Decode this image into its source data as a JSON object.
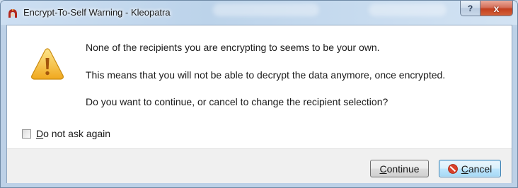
{
  "window": {
    "title": "Encrypt-To-Self Warning - Kleopatra",
    "help_glyph": "?",
    "close_glyph": "x"
  },
  "message": {
    "line1": "None of the recipients you are encrypting to seems to be your own.",
    "line2": "This means that you will not be able to decrypt the data anymore, once encrypted.",
    "line3": "Do you want to continue, or cancel to change the recipient selection?"
  },
  "checkbox": {
    "label_mnemonic": "D",
    "label_rest": "o not ask again",
    "checked": false
  },
  "buttons": {
    "continue_mnemonic": "C",
    "continue_rest": "ontinue",
    "cancel_mnemonic": "C",
    "cancel_rest": "ancel"
  },
  "icons": {
    "app": "kleopatra-icon",
    "warning": "warning-icon",
    "cancel": "cancel-icon"
  },
  "colors": {
    "warning_yellow": "#f6c03a",
    "cancel_red": "#d9412a",
    "close_red": "#c2401f"
  }
}
